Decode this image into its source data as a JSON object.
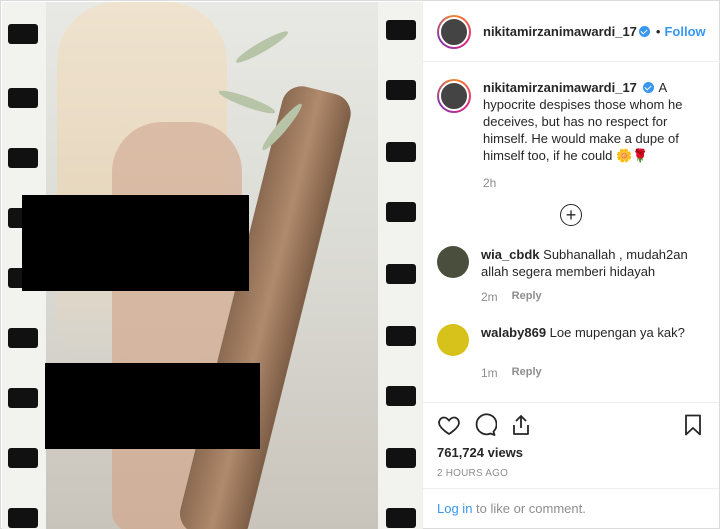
{
  "post": {
    "username": "nikitamirzanimawardi_17",
    "separator": "•",
    "follow_label": "Follow"
  },
  "caption": {
    "username": "nikitamirzanimawardi_17",
    "text": "A hypocrite despises those whom he deceives, but has no respect for himself. He would make a dupe of himself too, if he could 🌼🌹",
    "time": "2h"
  },
  "load_more": "+",
  "comments": [
    {
      "username": "wia_cbdk",
      "text": "Subhanallah , mudah2an allah segera memberi hidayah",
      "time": "2m",
      "reply": "Reply",
      "avatar_color": "#4a4f3d"
    },
    {
      "username": "walaby869",
      "text": "Loe mupengan ya kak?",
      "time": "1m",
      "reply": "Reply",
      "avatar_color": "#d6c21a"
    }
  ],
  "actions": {
    "icons": [
      "heart-icon",
      "comment-icon",
      "share-icon",
      "bookmark-icon"
    ],
    "views": "761,724 views",
    "posted_ago": "2 HOURS AGO"
  },
  "footer": {
    "login_link": "Log in",
    "login_rest": " to like or comment."
  },
  "colors": {
    "link_blue": "#3897f0",
    "muted": "#8e8e8e",
    "text": "#262626"
  }
}
